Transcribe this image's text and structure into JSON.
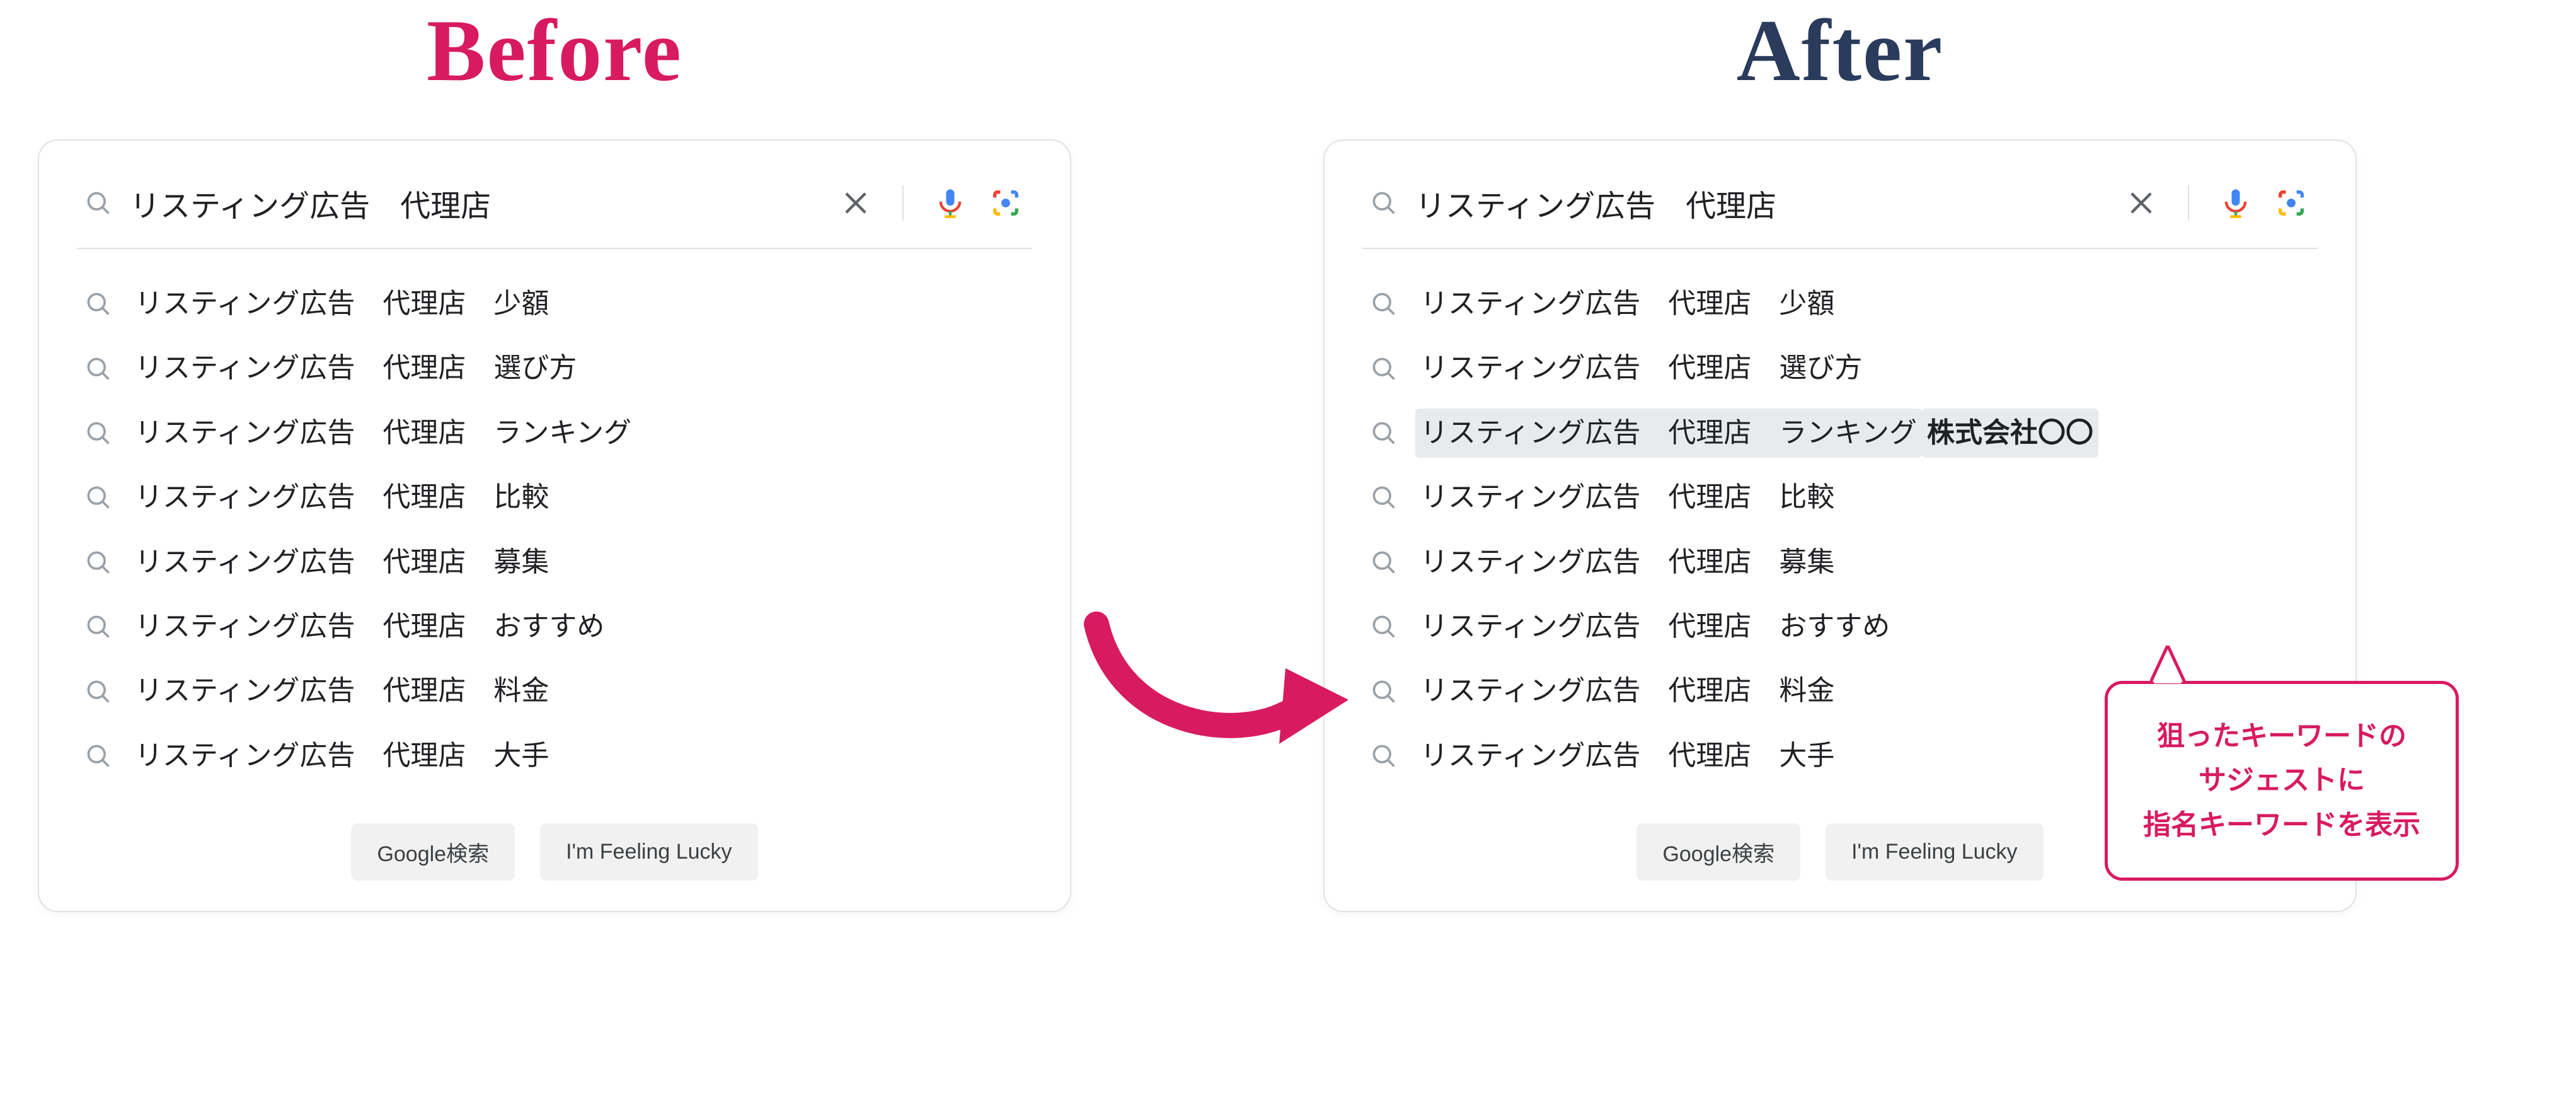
{
  "before": {
    "heading": "Before",
    "search_query": "リスティング広告　代理店",
    "suggestions": [
      {
        "text": "リスティング広告　代理店　少額"
      },
      {
        "text": "リスティング広告　代理店　選び方"
      },
      {
        "text": "リスティング広告　代理店　ランキング"
      },
      {
        "text": "リスティング広告　代理店　比較"
      },
      {
        "text": "リスティング広告　代理店　募集"
      },
      {
        "text": "リスティング広告　代理店　おすすめ"
      },
      {
        "text": "リスティング広告　代理店　料金"
      },
      {
        "text": "リスティング広告　代理店　大手"
      }
    ],
    "buttons": {
      "search": "Google検索",
      "lucky": "I'm Feeling Lucky"
    }
  },
  "after": {
    "heading": "After",
    "search_query": "リスティング広告　代理店",
    "suggestions": [
      {
        "text": "リスティング広告　代理店　少額"
      },
      {
        "text": "リスティング広告　代理店　選び方"
      },
      {
        "text": "リスティング広告　代理店　ランキング",
        "highlighted": true,
        "brand": "株式会社〇〇"
      },
      {
        "text": "リスティング広告　代理店　比較"
      },
      {
        "text": "リスティング広告　代理店　募集"
      },
      {
        "text": "リスティング広告　代理店　おすすめ"
      },
      {
        "text": "リスティング広告　代理店　料金"
      },
      {
        "text": "リスティング広告　代理店　大手"
      }
    ],
    "buttons": {
      "search": "Google検索",
      "lucky": "I'm Feeling Lucky"
    }
  },
  "bubble": {
    "line1": "狙ったキーワードの",
    "line2": "サジェストに",
    "line3": "指名キーワードを表示"
  }
}
